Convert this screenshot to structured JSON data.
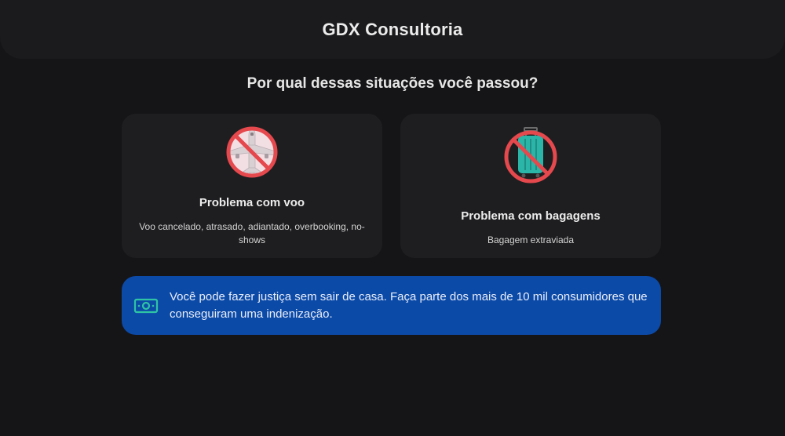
{
  "header": {
    "title": "GDX Consultoria"
  },
  "question": "Por qual dessas situações você passou?",
  "cards": [
    {
      "icon": "no-flight-icon",
      "title": "Problema com voo",
      "description": "Voo cancelado, atrasado, adiantado, overbooking, no-shows"
    },
    {
      "icon": "no-luggage-icon",
      "title": "Problema com bagagens",
      "description": "Bagagem extraviada"
    }
  ],
  "banner": {
    "icon": "money-icon",
    "text": "Você pode fazer justiça sem sair de casa. Faça parte dos mais de 10 mil consumidores que conseguiram uma indenização."
  },
  "colors": {
    "background": "#151517",
    "header": "#1b1b1d",
    "card": "#1e1e20",
    "banner": "#0c4aa8",
    "prohibition_red": "#e5484d",
    "luggage_teal": "#2bb5a8",
    "money_green": "#2ec4a4"
  }
}
